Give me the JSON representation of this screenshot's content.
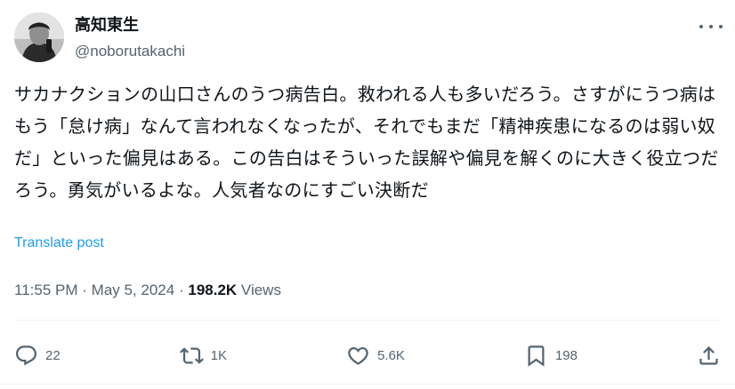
{
  "author": {
    "display_name": "高知東生",
    "handle": "@noborutakachi"
  },
  "post": {
    "text": "サカナクションの山口さんのうつ病告白。救われる人も多いだろう。さすがにうつ病はもう「怠け病」なんて言われなくなったが、それでもまだ「精神疾患になるのは弱い奴だ」といった偏見はある。この告白はそういった誤解や偏見を解くのに大きく役立つだろう。勇気がいるよな。人気者なのにすごい決断だ",
    "translate_label": "Translate post"
  },
  "meta": {
    "time": "11:55 PM",
    "separator": "·",
    "date": "May 5, 2024",
    "views_count": "198.2K",
    "views_label": "Views"
  },
  "actions": {
    "reply_count": "22",
    "repost_count": "1K",
    "like_count": "5.6K",
    "bookmark_count": "198"
  },
  "icons": {
    "more": "more-icon",
    "reply": "reply-icon",
    "repost": "repost-icon",
    "like": "heart-icon",
    "bookmark": "bookmark-icon",
    "share": "share-icon"
  }
}
